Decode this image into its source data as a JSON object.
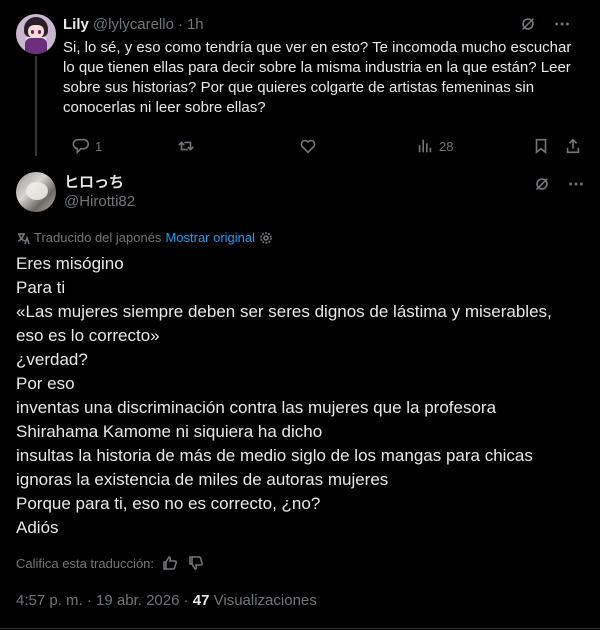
{
  "reply": {
    "name": "Lily",
    "handle": "@lylycarello",
    "separator": "·",
    "time": "1h",
    "text": "Si, lo sé, y eso como tendría que ver en esto? Te incomoda mucho escuchar lo que tienen ellas para decir sobre la misma industria en la que están? Leer sobre sus historias? Por que quieres colgarte de artistas femeninas sin conocerlas ni leer sobre ellas?",
    "actions": {
      "reply_count": "1",
      "retweet_count": "",
      "like_count": "",
      "views_count": "28"
    }
  },
  "main": {
    "name": "ヒロっち",
    "handle": "@Hirotti82",
    "translated_label": "Traducido del japonés",
    "show_original": "Mostrar original",
    "lines": [
      "Eres misógino",
      "Para ti",
      "«Las mujeres siempre deben ser seres dignos de lástima y miserables,",
      "eso es lo correcto»",
      "¿verdad?",
      "Por eso",
      "inventas una discriminación contra las mujeres que la profesora",
      "Shirahama Kamome ni siquiera ha dicho",
      "insultas la historia de más de medio siglo de los mangas para chicas",
      "ignoras la existencia de miles de autoras mujeres",
      "Porque para ti, eso no es correcto, ¿no?",
      "Adiós"
    ],
    "rate_label": "Califica esta traducción:",
    "meta_time": "4:57 p. m. · 19 abr. 2026 · ",
    "views_count": "47",
    "views_label": " Visualizaciones"
  },
  "icons": {
    "grok": "grok-icon",
    "more": "more-icon",
    "reply": "reply-icon",
    "retweet": "retweet-icon",
    "like": "like-icon",
    "views": "views-icon",
    "bookmark": "bookmark-icon",
    "share": "share-icon",
    "translate": "translate-icon",
    "settings": "gear-icon",
    "thumbs_up": "thumbs-up-icon",
    "thumbs_down": "thumbs-down-icon"
  },
  "colors": {
    "background": "#000000",
    "text": "#e7e9ea",
    "muted": "#71767b",
    "link": "#1d9bf0",
    "border": "#2f3336"
  }
}
